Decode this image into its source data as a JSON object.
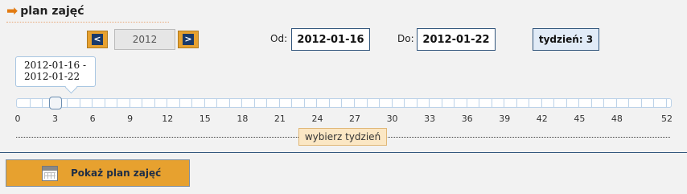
{
  "header": {
    "arrow_icon": "right-arrow-icon",
    "title": "plan zajęć"
  },
  "year": {
    "prev_icon": "chevron-left-icon",
    "value": "2012",
    "next_icon": "chevron-right-icon"
  },
  "dates": {
    "from_label": "Od:",
    "from_value": "2012-01-16",
    "to_label": "Do:",
    "to_value": "2012-01-22"
  },
  "week": {
    "text": "tydzień: 3"
  },
  "slider": {
    "tooltip_line1": "2012-01-16 -",
    "tooltip_line2": "2012-01-22",
    "min": 0,
    "max": 52,
    "value": 3,
    "ticks": [
      "0",
      "3",
      "6",
      "9",
      "12",
      "15",
      "18",
      "21",
      "24",
      "27",
      "30",
      "33",
      "36",
      "39",
      "42",
      "45",
      "48",
      "52"
    ],
    "pick_label": "wybierz tydzień"
  },
  "action": {
    "button_label": "Pokaż plan zajęć",
    "icon": "calendar-icon"
  },
  "colors": {
    "accent": "#e7a12f",
    "navy": "#33577d",
    "icon_navy": "#1a3a6a",
    "header_arrow": "#e27b12"
  }
}
